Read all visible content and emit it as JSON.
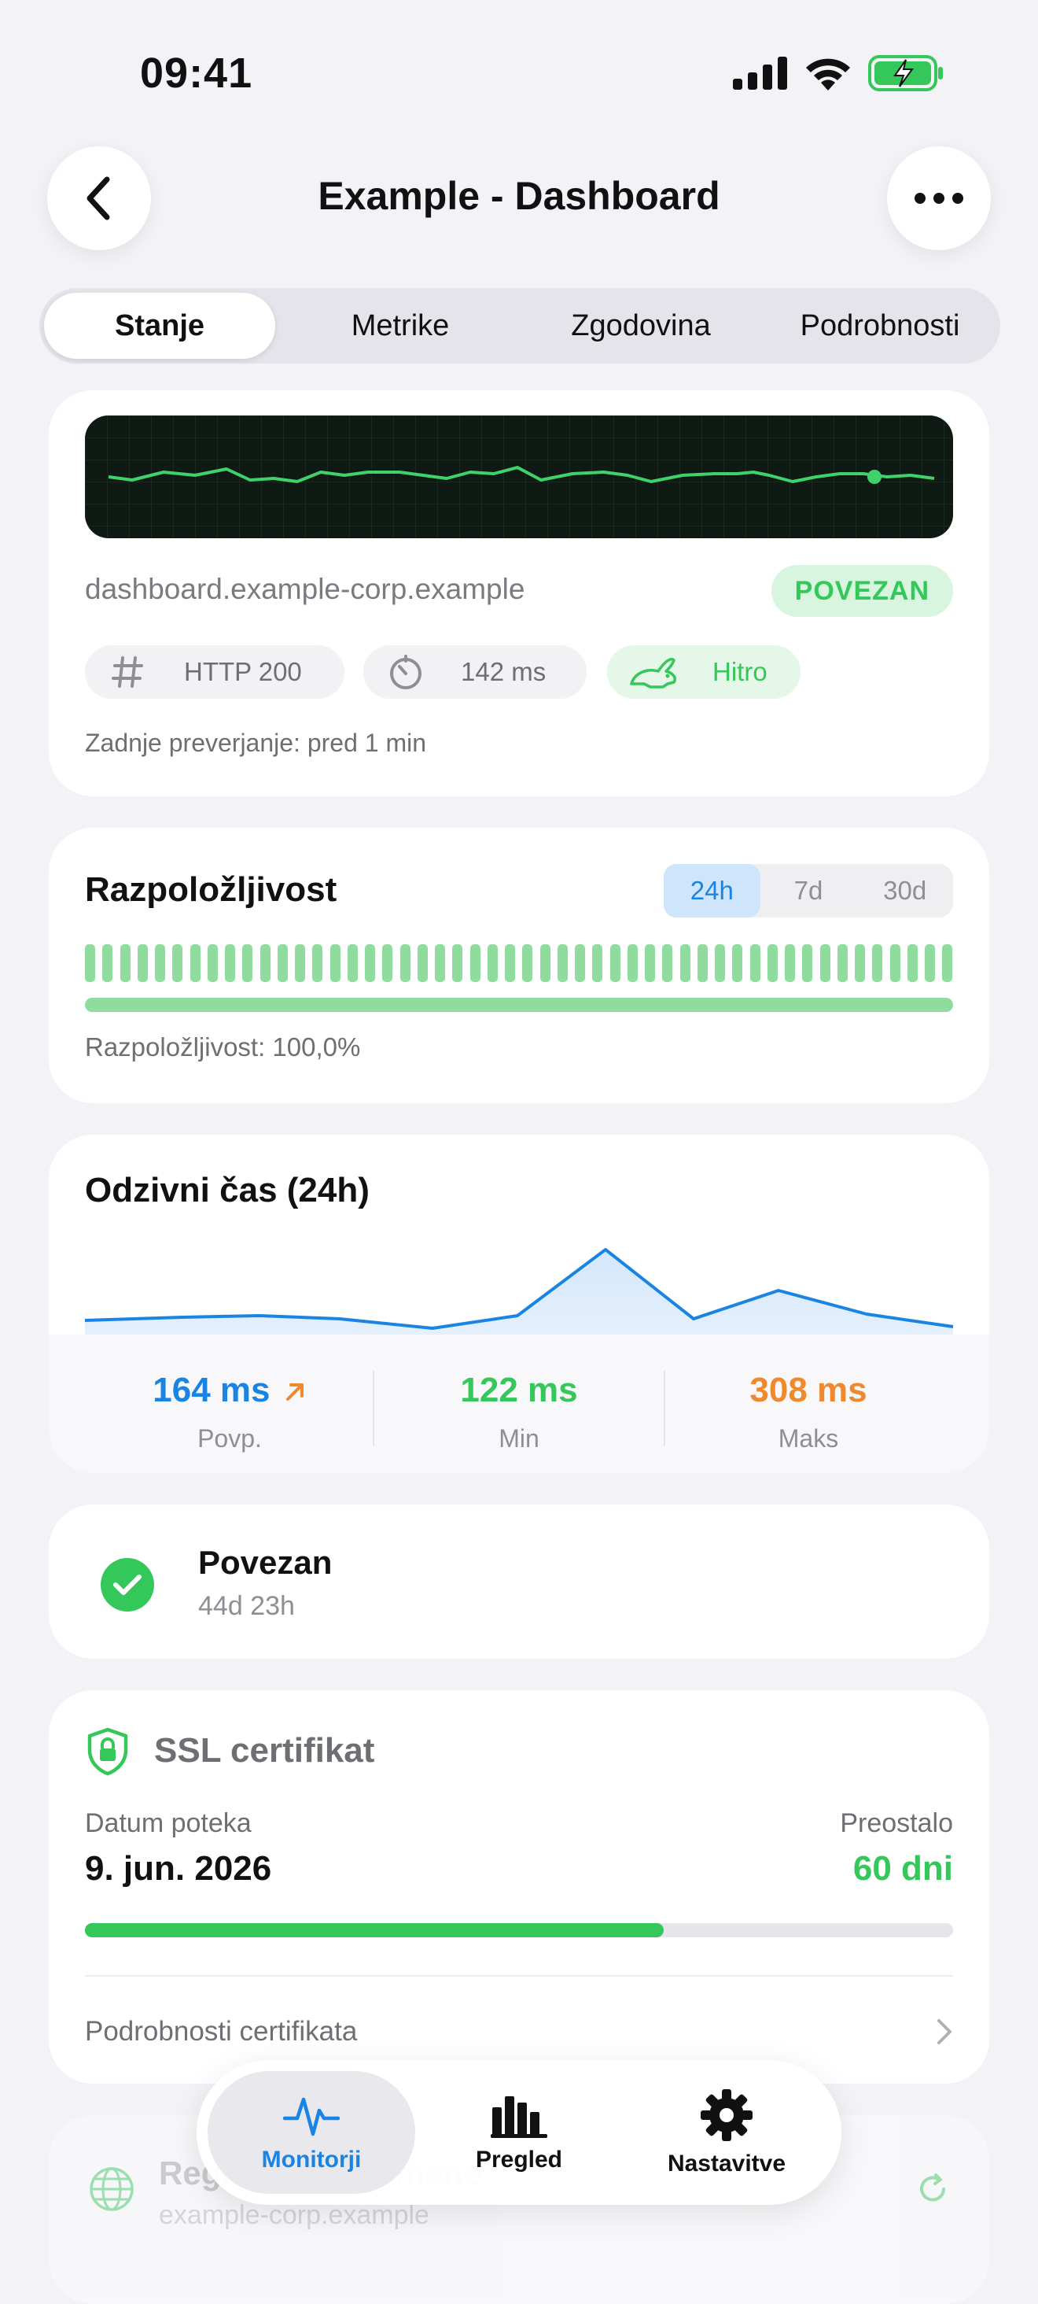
{
  "status_bar": {
    "time": "09:41"
  },
  "nav": {
    "title": "Example - Dashboard"
  },
  "tabs": [
    "Stanje",
    "Metrike",
    "Zgodovina",
    "Podrobnosti"
  ],
  "monitor": {
    "url": "dashboard.example-corp.example",
    "status": "POVEZAN",
    "http": "HTTP 200",
    "latency": "142 ms",
    "speed": "Hitro",
    "last_check": "Zadnje preverjanje: pred 1 min"
  },
  "availability": {
    "title": "Razpoložljivost",
    "ranges": [
      "24h",
      "7d",
      "30d"
    ],
    "selected_range": "24h",
    "text": "Razpoložljivost: 100,0%",
    "uptime_fraction": 1.0
  },
  "response": {
    "title": "Odzivni čas (24h)",
    "avg_value": "164 ms",
    "avg_label": "Povp.",
    "min_value": "122 ms",
    "min_label": "Min",
    "max_value": "308 ms",
    "max_label": "Maks",
    "colors": {
      "avg": "#1a84e5",
      "min": "#34c759",
      "max": "#f0892b"
    }
  },
  "connection": {
    "title": "Povezan",
    "duration": "44d 23h"
  },
  "ssl": {
    "title": "SSL certifikat",
    "expiry_label": "Datum poteka",
    "expiry_date": "9. jun. 2026",
    "remaining_label": "Preostalo",
    "remaining_value": "60 dni",
    "remaining_fraction": 0.667,
    "details_link": "Podrobnosti certifikata"
  },
  "hidden_card": {
    "title": "Registracija domene",
    "subtitle": "example-corp.example"
  },
  "tabbar": {
    "items": [
      {
        "label": "Monitorji",
        "icon": "waveform-icon"
      },
      {
        "label": "Pregled",
        "icon": "bar-chart-icon"
      },
      {
        "label": "Nastavitve",
        "icon": "gear-icon"
      }
    ]
  }
}
